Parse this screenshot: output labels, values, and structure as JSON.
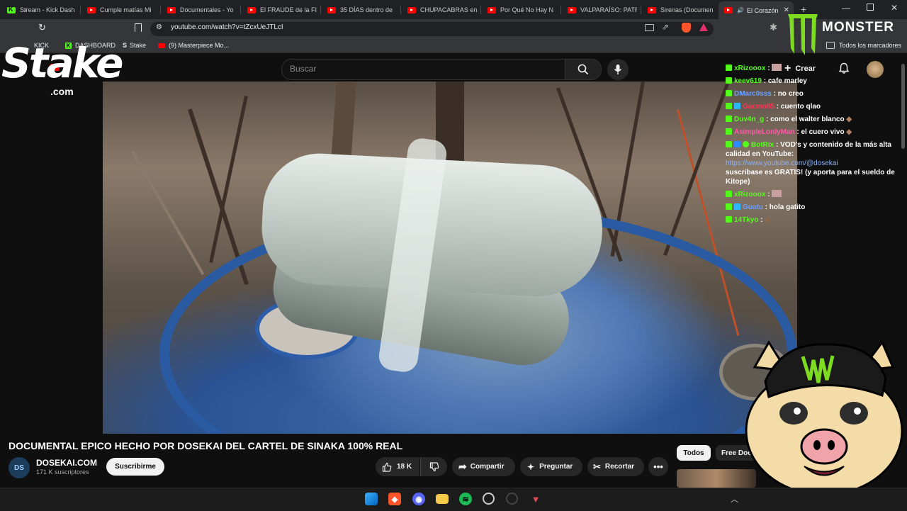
{
  "browser": {
    "tabs": [
      {
        "label": "Stream - Kick Dash",
        "icon": "kick-icon"
      },
      {
        "label": "Cumple matías Mi",
        "icon": "youtube-icon"
      },
      {
        "label": "Documentales - Yo",
        "icon": "youtube-icon"
      },
      {
        "label": "El FRAUDE de la FI",
        "icon": "youtube-icon"
      },
      {
        "label": "35 DÍAS dentro de",
        "icon": "youtube-icon"
      },
      {
        "label": "CHUPACABRAS en",
        "icon": "youtube-icon"
      },
      {
        "label": "Por Qué No Hay N",
        "icon": "youtube-icon"
      },
      {
        "label": "VALPARAÍSO: PATR",
        "icon": "youtube-icon"
      },
      {
        "label": "Sirenas (Documen",
        "icon": "youtube-icon"
      },
      {
        "label": "El Corazón",
        "icon": "youtube-icon",
        "active": true
      }
    ],
    "new_tab": "+",
    "url": "youtube.com/watch?v=tZcxUeJTLcI",
    "bookmarks": [
      {
        "label": "KICK",
        "icon": "kick-icon"
      },
      {
        "label": "DASHBOARD",
        "icon": "kick-icon"
      },
      {
        "label": "Stake",
        "icon": "stake-icon"
      },
      {
        "label": "(9) Masterpiece Mo...",
        "icon": "youtube-icon"
      }
    ],
    "all_bookmarks": "Todos los marcadores"
  },
  "overlay": {
    "stake_logo": "Stake",
    "stake_com": ".com",
    "monster_logo": "MONSTER"
  },
  "youtube": {
    "search_placeholder": "Buscar",
    "create_label": "Crear",
    "video_title": "DOCUMENTAL EPICO HECHO POR DOSEKAI DEL CARTEL DE SINAKA 100% REAL",
    "channel_name": "DOSEKAI.COM",
    "channel_subs": "171 K suscriptores",
    "subscribe_label": "Suscribirme",
    "like_count": "18 K",
    "share_label": "Compartir",
    "ask_label": "Preguntar",
    "clip_label": "Recortar",
    "chip_all": "Todos",
    "chip_free": "Free Doc"
  },
  "chat": [
    {
      "user": "xRizooox",
      "color": "#53fc18",
      "text": ""
    },
    {
      "user": "keev619",
      "color": "#53fc18",
      "text": "cafe marley"
    },
    {
      "user": "DMarc0sss",
      "color": "#6aa0ff",
      "text": "no creo"
    },
    {
      "user": "Gacmo85",
      "color": "#ff3355",
      "text": "cuento qlao"
    },
    {
      "user": "Duv4n_g",
      "color": "#53fc18",
      "text": "como el walter blanco"
    },
    {
      "user": "AsimpleLonlyMan",
      "color": "#ff5ca8",
      "text": "el cuero vivo"
    },
    {
      "user": "BotRix",
      "color": "#53fc18",
      "text": "VOD's y contenido de la más alta calidad en YouTube:",
      "link": "https://www.youtube.com/@dosekai",
      "text2": "suscribase es GRATIS! (y aporta para el sueldo de Kitope)"
    },
    {
      "user": "xRizooox",
      "color": "#53fc18",
      "text": ""
    },
    {
      "user": "Guatu",
      "color": "#6aa0ff",
      "text": "hola gatito"
    },
    {
      "user": "14Tkyo",
      "color": "#53fc18",
      "text": ""
    }
  ]
}
